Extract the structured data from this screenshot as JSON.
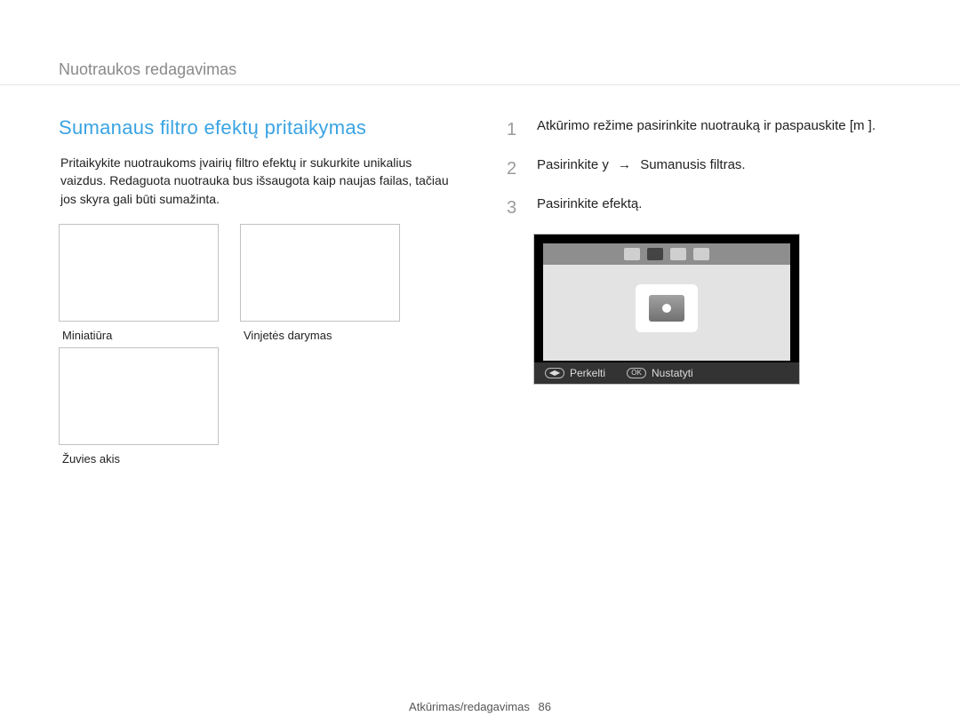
{
  "header": {
    "breadcrumb": "Nuotraukos redagavimas"
  },
  "left": {
    "title": "Sumanaus ﬁltro efektų pritaikymas",
    "intro": "Pritaikykite nuotraukoms įvairių ﬁltro efektų ir sukurkite unikalius vaizdus. Redaguota nuotrauka bus išsaugota kaip naujas failas, tačiau jos skyra gali būti sumažinta.",
    "thumbs": [
      {
        "caption": "Miniatiūra"
      },
      {
        "caption": "Vinjetės darymas"
      },
      {
        "caption": "Žuvies akis"
      }
    ]
  },
  "right": {
    "steps": [
      {
        "num": "1",
        "text_a": "Atkūrimo režime pasirinkite nuotrauką ir paspauskite",
        "text_b": "[m       ]."
      },
      {
        "num": "2",
        "text_a": "Pasirinkite y",
        "arrow": "→",
        "text_b": "Sumanusis ﬁltras."
      },
      {
        "num": "3",
        "text_a": "Pasirinkite efektą."
      }
    ],
    "screenshot": {
      "bottom_left": "Perkelti",
      "bottom_right": "Nustatyti",
      "bottom_left_icon": "◀▶",
      "bottom_right_icon": "OK"
    }
  },
  "footer": {
    "section": "Atkūrimas/redagavimas",
    "page": "86"
  }
}
